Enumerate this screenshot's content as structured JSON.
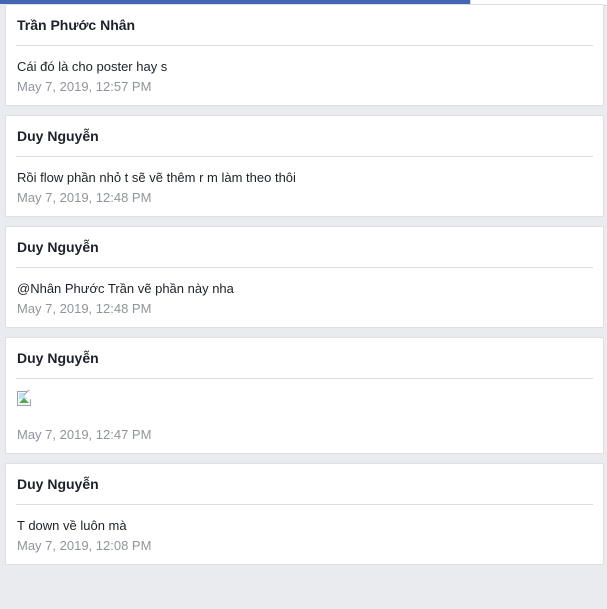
{
  "comments": [
    {
      "author": "Trần Phước Nhân",
      "text": "Cái đó là cho poster hay s",
      "time": "May 7, 2019, 12:57 PM"
    },
    {
      "author": "Duy Nguyễn",
      "text": "Rồi flow phần nhỏ t sẽ vẽ thêm r m làm theo thôi",
      "time": "May 7, 2019, 12:48 PM"
    },
    {
      "author": "Duy Nguyễn",
      "text": "@Nhân Phước Trần vẽ phần này nha",
      "time": "May 7, 2019, 12:48 PM"
    },
    {
      "author": "Duy Nguyễn",
      "image": "broken-image-icon",
      "time": "May 7, 2019, 12:47 PM"
    },
    {
      "author": "Duy Nguyễn",
      "text": "T down về luôn mà",
      "time": "May 7, 2019, 12:08 PM"
    }
  ],
  "colors": {
    "header_blue": "#4267b2",
    "background": "#e9ebee",
    "timestamp": "#90949c"
  }
}
